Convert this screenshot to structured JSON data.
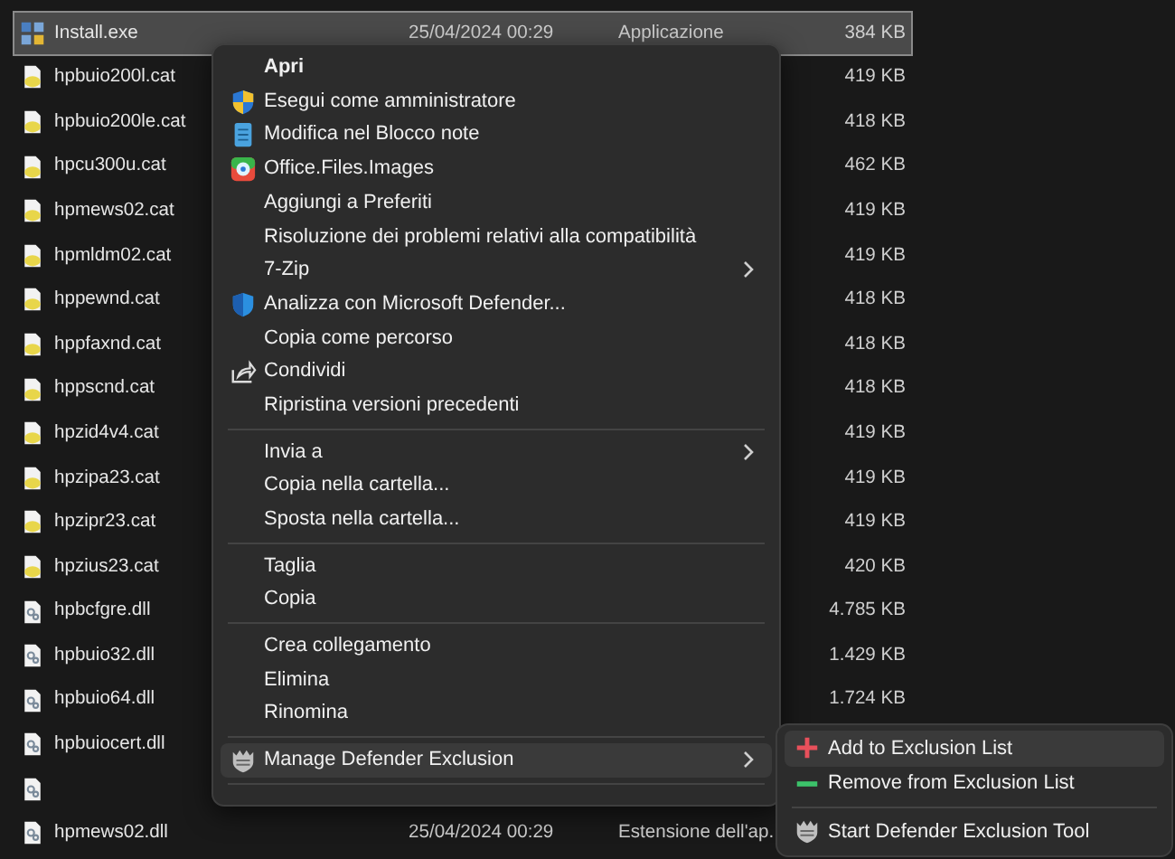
{
  "files": [
    {
      "kind": "app",
      "name": "Install.exe",
      "date": "25/04/2024 00:29",
      "type": "Applicazione",
      "size": "384 KB",
      "selected": true
    },
    {
      "kind": "catalog",
      "name": "hpbuio200l.cat",
      "size": "419 KB",
      "selected": false
    },
    {
      "kind": "catalog",
      "name": "hpbuio200le.cat",
      "size": "418 KB",
      "selected": false
    },
    {
      "kind": "catalog",
      "name": "hpcu300u.cat",
      "size": "462 KB",
      "selected": false
    },
    {
      "kind": "catalog",
      "name": "hpmews02.cat",
      "size": "419 KB",
      "selected": false
    },
    {
      "kind": "catalog",
      "name": "hpmldm02.cat",
      "size": "419 KB",
      "selected": false
    },
    {
      "kind": "catalog",
      "name": "hppewnd.cat",
      "size": "418 KB",
      "selected": false
    },
    {
      "kind": "catalog",
      "name": "hppfaxnd.cat",
      "size": "418 KB",
      "selected": false
    },
    {
      "kind": "catalog",
      "name": "hppscnd.cat",
      "size": "418 KB",
      "selected": false
    },
    {
      "kind": "catalog",
      "name": "hpzid4v4.cat",
      "size": "419 KB",
      "selected": false
    },
    {
      "kind": "catalog",
      "name": "hpzipa23.cat",
      "size": "419 KB",
      "selected": false
    },
    {
      "kind": "catalog",
      "name": "hpzipr23.cat",
      "size": "419 KB",
      "selected": false
    },
    {
      "kind": "catalog",
      "name": "hpzius23.cat",
      "size": "420 KB",
      "selected": false
    },
    {
      "kind": "library",
      "name": "hpbcfgre.dll",
      "size": "4.785 KB",
      "selected": false
    },
    {
      "kind": "library",
      "name": "hpbuio32.dll",
      "size": "1.429 KB",
      "selected": false
    },
    {
      "kind": "library",
      "name": "hpbuio64.dll",
      "size": "1.724 KB",
      "selected": false
    },
    {
      "kind": "library",
      "name": "hpbuiocert.dll",
      "selected": false
    },
    {
      "kind": "library",
      "selected": false
    },
    {
      "kind": "library",
      "name": "hpmews02.dll",
      "date": "25/04/2024 00:29",
      "type": "Estensione dell'ap.",
      "selected": false
    }
  ],
  "context_menu": {
    "items": [
      {
        "kind": "plain",
        "label": "Apri",
        "bold": true,
        "submenu": false,
        "selected": false
      },
      {
        "kind": "shield",
        "label": "Esegui come amministratore",
        "bold": false,
        "submenu": false,
        "selected": false
      },
      {
        "kind": "notepad",
        "label": "Modifica nel Blocco note",
        "bold": false,
        "submenu": false,
        "selected": false
      },
      {
        "kind": "photos",
        "label": "Office.Files.Images",
        "bold": false,
        "submenu": false,
        "selected": false
      },
      {
        "kind": "plain",
        "label": "Aggiungi a Preferiti",
        "bold": false,
        "submenu": false,
        "selected": false
      },
      {
        "kind": "plain",
        "label": "Risoluzione dei problemi relativi alla compatibilità",
        "bold": false,
        "submenu": false,
        "selected": false
      },
      {
        "kind": "plain",
        "label": "7-Zip",
        "bold": false,
        "submenu": true,
        "selected": false
      },
      {
        "kind": "defender",
        "label": "Analizza con Microsoft Defender...",
        "bold": false,
        "submenu": false,
        "selected": false
      },
      {
        "kind": "plain",
        "label": "Copia come percorso",
        "bold": false,
        "submenu": false,
        "selected": false
      },
      {
        "kind": "share",
        "label": "Condividi",
        "bold": false,
        "submenu": false,
        "selected": false
      },
      {
        "kind": "plain",
        "label": "Ripristina versioni precedenti",
        "bold": false,
        "submenu": false,
        "selected": false
      },
      {
        "kind": "separator"
      },
      {
        "kind": "plain",
        "label": "Invia a",
        "bold": false,
        "submenu": true,
        "selected": false
      },
      {
        "kind": "plain",
        "label": "Copia nella cartella...",
        "bold": false,
        "submenu": false,
        "selected": false
      },
      {
        "kind": "plain",
        "label": "Sposta nella cartella...",
        "bold": false,
        "submenu": false,
        "selected": false
      },
      {
        "kind": "separator"
      },
      {
        "kind": "plain",
        "label": "Taglia",
        "bold": false,
        "submenu": false,
        "selected": false
      },
      {
        "kind": "plain",
        "label": "Copia",
        "bold": false,
        "submenu": false,
        "selected": false
      },
      {
        "kind": "separator"
      },
      {
        "kind": "plain",
        "label": "Crea collegamento",
        "bold": false,
        "submenu": false,
        "selected": false
      },
      {
        "kind": "plain",
        "label": "Elimina",
        "bold": false,
        "submenu": false,
        "selected": false
      },
      {
        "kind": "plain",
        "label": "Rinomina",
        "bold": false,
        "submenu": false,
        "selected": false
      },
      {
        "kind": "separator"
      },
      {
        "kind": "tool",
        "label": "Manage Defender Exclusion",
        "bold": false,
        "submenu": true,
        "selected": true
      },
      {
        "kind": "separator"
      }
    ]
  },
  "submenu": {
    "items": [
      {
        "kind": "plus",
        "label": "Add to Exclusion List",
        "selected": true
      },
      {
        "kind": "minus",
        "label": "Remove from Exclusion List",
        "selected": false
      },
      {
        "kind": "separator"
      },
      {
        "kind": "tool",
        "label": "Start Defender Exclusion Tool",
        "selected": false
      }
    ]
  }
}
